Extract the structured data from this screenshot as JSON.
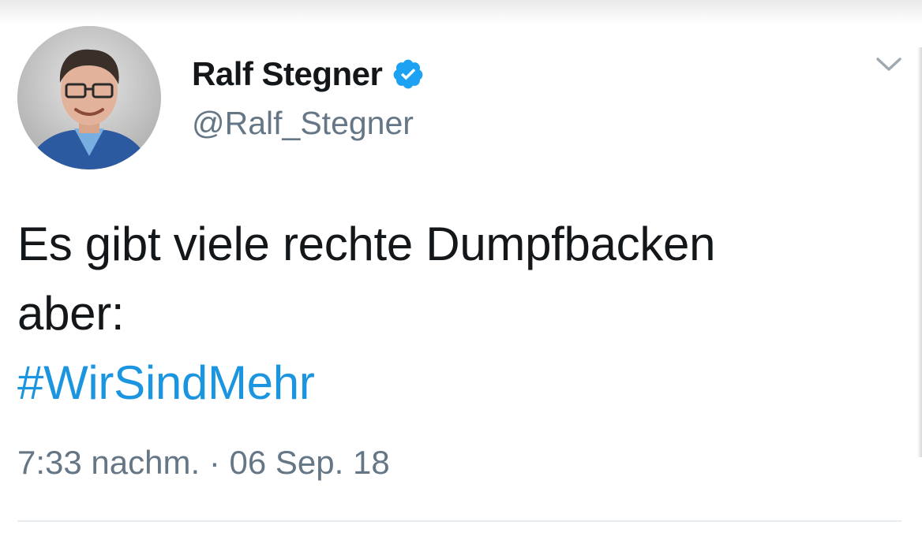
{
  "tweet": {
    "author": {
      "display_name": "Ralf Stegner",
      "handle": "@Ralf_Stegner",
      "verified": true,
      "avatar": "profile-photo"
    },
    "text_lines": [
      "Es gibt viele rechte Dumpfbacken",
      "aber:"
    ],
    "hashtag": "#WirSindMehr",
    "time": "7:33 nachm.",
    "separator": "·",
    "date": "06 Sep. 18",
    "menu_icon": "chevron-down-icon"
  },
  "colors": {
    "text": "#14171a",
    "secondary": "#657786",
    "link": "#1b95e0",
    "verified": "#1da1f2"
  }
}
